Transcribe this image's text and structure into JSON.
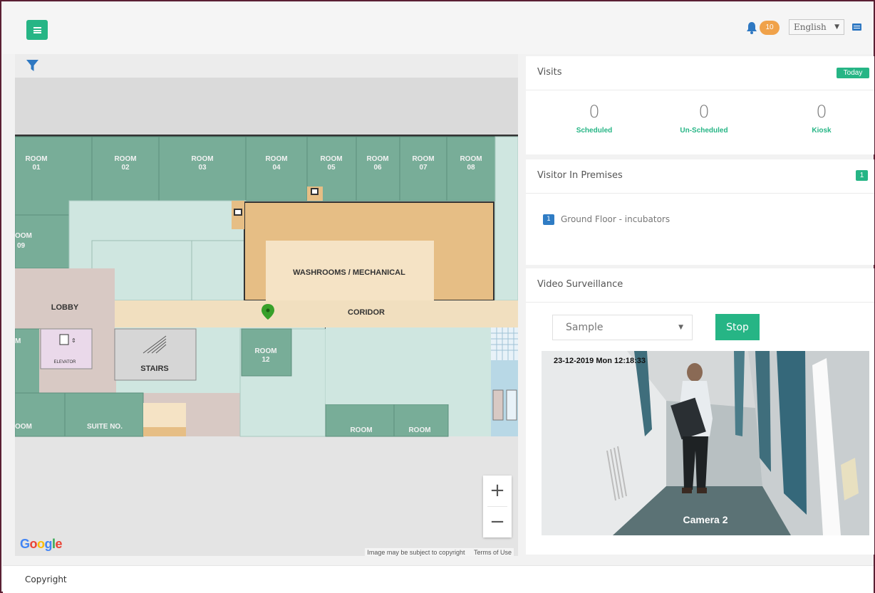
{
  "header": {
    "menu_icon": "hamburger-icon",
    "bell_icon": "bell-icon",
    "notification_count": "10",
    "language_selected": "English",
    "messages_icon": "messages-icon"
  },
  "map": {
    "filter_icon": "filter-icon",
    "rooms": {
      "room01_a": "ROOM",
      "room01_b": "01",
      "room02_a": "ROOM",
      "room02_b": "02",
      "room03_a": "ROOM",
      "room03_b": "03",
      "room04_a": "ROOM",
      "room04_b": "04",
      "room05_a": "ROOM",
      "room05_b": "05",
      "room06_a": "ROOM",
      "room06_b": "06",
      "room07_a": "ROOM",
      "room07_b": "07",
      "room08_a": "ROOM",
      "room08_b": "08",
      "room09_a": "OOM",
      "room09_b": "09",
      "room12_a": "ROOM",
      "room12_b": "12",
      "washrooms": "WASHROOMS / MECHANICAL",
      "lobby": "LOBBY",
      "coridor": "CORIDOR",
      "elevator": "ELEVATOR",
      "stairs": "STAIRS",
      "suite": "SUITE NO.",
      "room_bl": "OOM",
      "room_m": "M",
      "room_b1": "ROOM",
      "room_b2": "ROOM"
    },
    "zoom_in": "+",
    "zoom_out": "−",
    "google": "Google",
    "copyright_notice": "Image may be subject to copyright",
    "terms": "Terms of Use"
  },
  "visits": {
    "title": "Visits",
    "badge": "Today",
    "stats": [
      {
        "value": "0",
        "label": "Scheduled"
      },
      {
        "value": "0",
        "label": "Un-Scheduled"
      },
      {
        "value": "0",
        "label": "Kiosk"
      }
    ]
  },
  "premises": {
    "title": "Visitor In Premises",
    "badge": "1",
    "item_count": "1",
    "item_label": "Ground Floor - incubators"
  },
  "video": {
    "title": "Video Surveillance",
    "camera_selected": "Sample",
    "stop_label": "Stop",
    "timestamp": "23-12-2019 Mon 12:18:33",
    "camera_name": "Camera 2"
  },
  "footer": {
    "text": "Copyright"
  },
  "colors": {
    "accent": "#26b585",
    "badge_orange": "#f0a24a",
    "badge_blue": "#2f7cc4",
    "room_green": "#78ad98",
    "room_light": "#cfe6e0",
    "washroom": "#e6be85",
    "corridor": "#f1dfbf",
    "lobby": "#d8c9c4",
    "marker": "#38a02a"
  }
}
